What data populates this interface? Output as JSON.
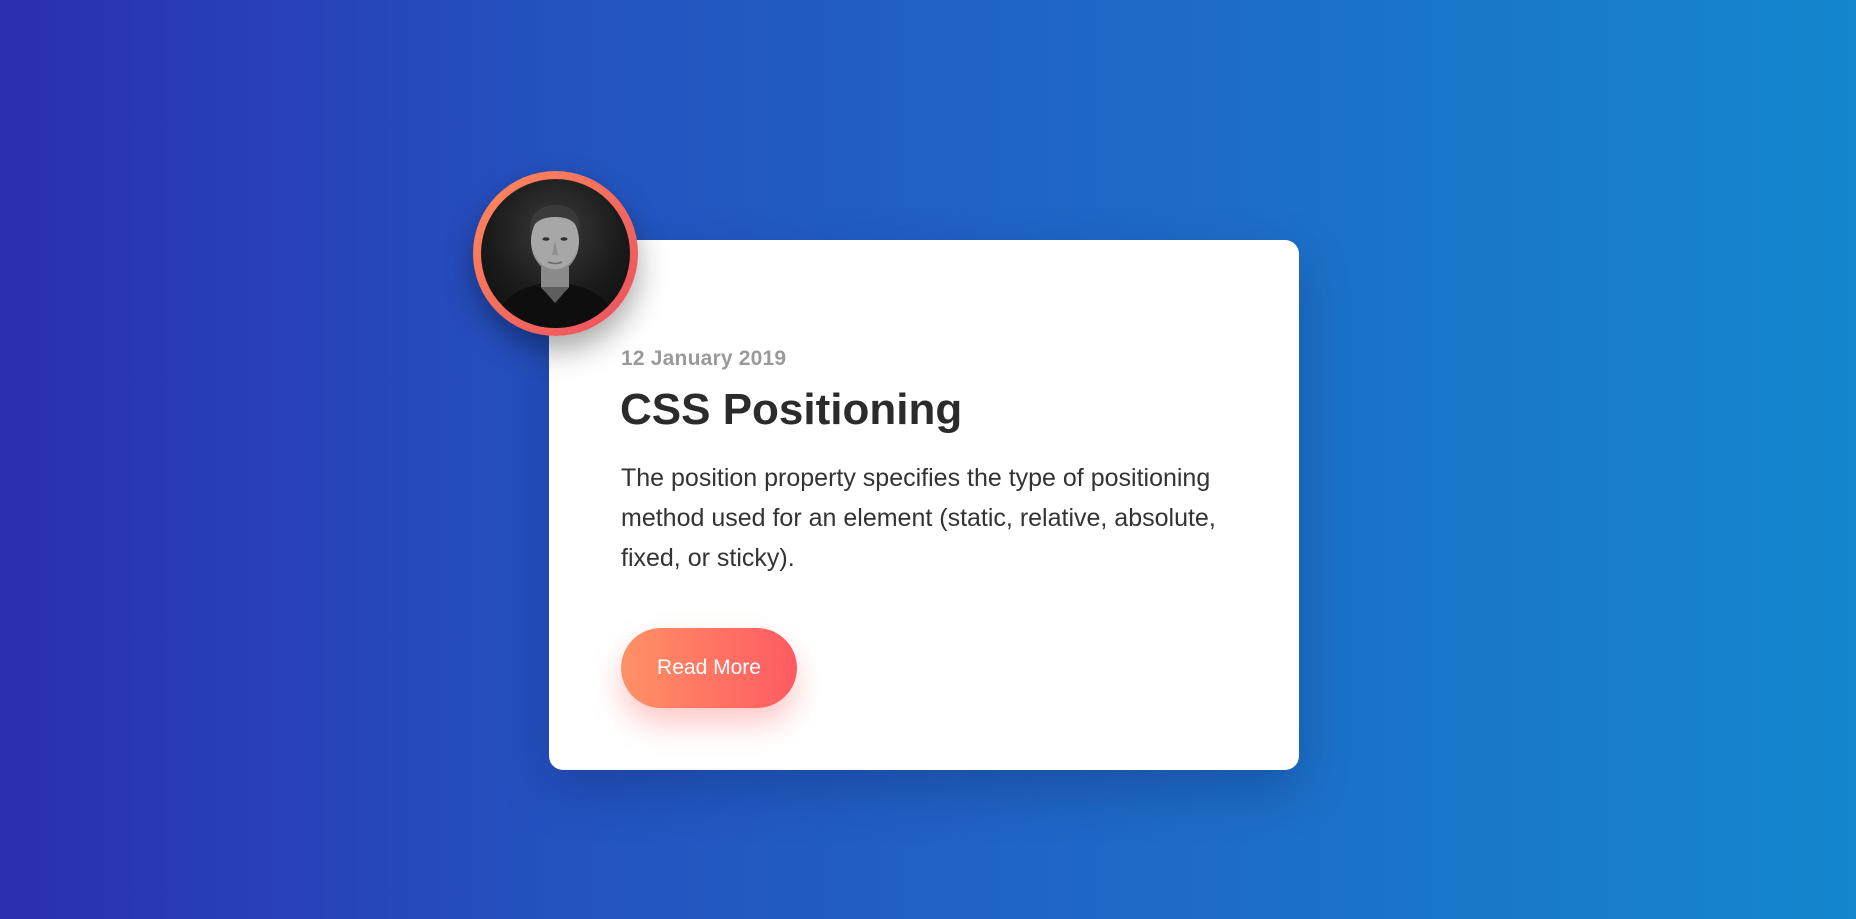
{
  "card": {
    "date": "12 January 2019",
    "title": "CSS Positioning",
    "description": "The position property specifies the type of positioning method used for an element (static, relative, absolute, fixed, or sticky).",
    "button_label": "Read More",
    "avatar_icon": "author-portrait"
  },
  "colors": {
    "background_start": "#2b2fb0",
    "background_end": "#1487cf",
    "button_start": "#ff9165",
    "button_end": "#ff5a62",
    "avatar_ring": "#ea4f5f"
  }
}
